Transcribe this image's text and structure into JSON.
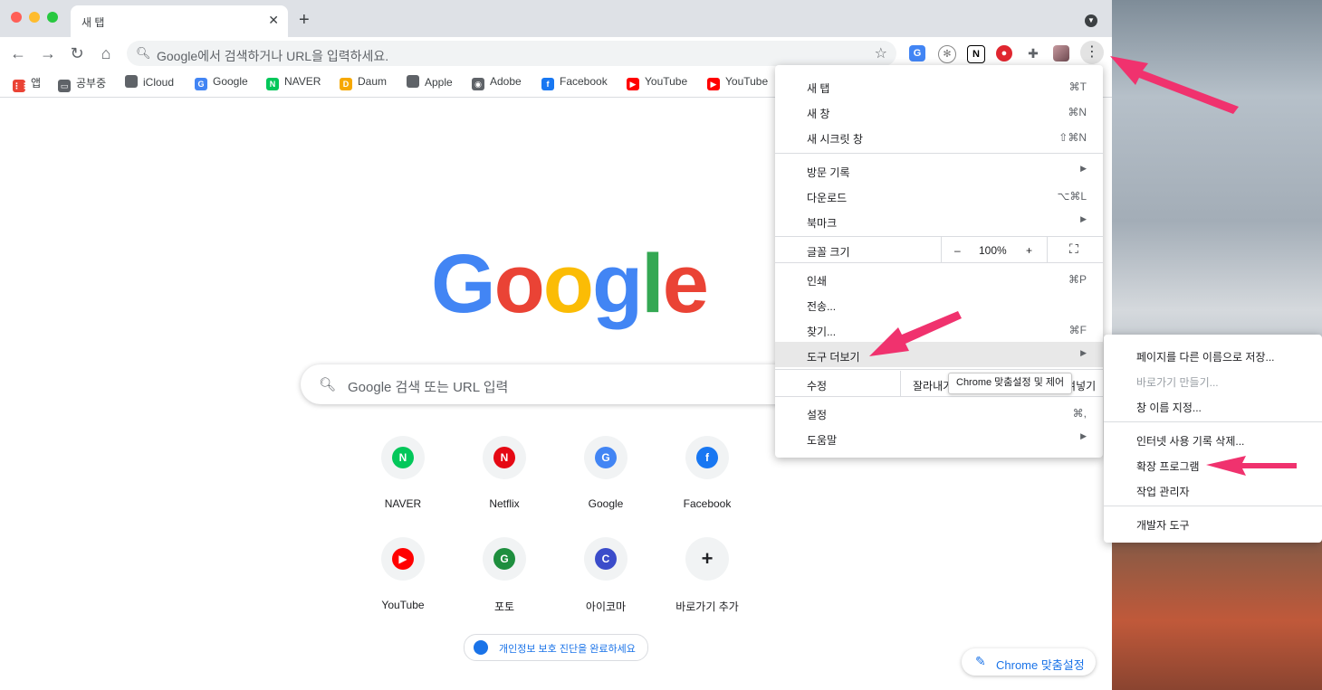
{
  "tab": {
    "title": "새 탭"
  },
  "omnibox": {
    "placeholder": "Google에서 검색하거나 URL을 입력하세요."
  },
  "bookmarks": [
    {
      "label": "앱",
      "icon": "apps-grid-icon"
    },
    {
      "label": "공부중",
      "icon": "folder-icon"
    },
    {
      "label": "iCloud",
      "icon": "apple-icon"
    },
    {
      "label": "Google",
      "icon": "google-icon"
    },
    {
      "label": "NAVER",
      "icon": "naver-icon"
    },
    {
      "label": "Daum",
      "icon": "daum-icon"
    },
    {
      "label": "Apple",
      "icon": "apple-icon"
    },
    {
      "label": "Adobe",
      "icon": "adobe-icon"
    },
    {
      "label": "Facebook",
      "icon": "facebook-icon"
    },
    {
      "label": "YouTube",
      "icon": "youtube-icon"
    },
    {
      "label": "YouTube",
      "icon": "youtube-music-icon"
    }
  ],
  "logo": {
    "letters": [
      "G",
      "o",
      "o",
      "g",
      "l",
      "e"
    ],
    "colors": [
      "#4285f4",
      "#ea4335",
      "#fbbc05",
      "#4285f4",
      "#34a853",
      "#ea4335"
    ]
  },
  "search": {
    "placeholder": "Google 검색 또는 URL 입력"
  },
  "tiles": [
    {
      "label": "NAVER",
      "glyph": "N",
      "color": "#03c75a"
    },
    {
      "label": "Netflix",
      "glyph": "N",
      "color": "#e50914"
    },
    {
      "label": "Google",
      "glyph": "G",
      "color": "#4285f4"
    },
    {
      "label": "Facebook",
      "glyph": "f",
      "color": "#1877f2"
    },
    {
      "label": "YouTube",
      "glyph": "▶",
      "color": "#ff0000"
    },
    {
      "label": "포토",
      "glyph": "G",
      "color": "#1e8e3e"
    },
    {
      "label": "아이코마",
      "glyph": "C",
      "color": "#3b4cca"
    },
    {
      "label": "바로가기 추가",
      "glyph": "+",
      "color": "#202124"
    }
  ],
  "privacy": {
    "label": "개인정보 보호 진단을 완료하세요"
  },
  "customize": {
    "label": "Chrome 맞춤설정"
  },
  "menu": {
    "new_tab": "새 탭",
    "new_tab_sc": "⌘T",
    "new_window": "새 창",
    "new_window_sc": "⌘N",
    "incognito": "새 시크릿 창",
    "incognito_sc": "⇧⌘N",
    "history": "방문 기록",
    "downloads": "다운로드",
    "downloads_sc": "⌥⌘L",
    "bookmarks": "북마크",
    "zoom": "글꼴 크기",
    "zoom_minus": "–",
    "zoom_value": "100%",
    "zoom_plus": "+",
    "print": "인쇄",
    "print_sc": "⌘P",
    "cast": "전송...",
    "find": "찾기...",
    "find_sc": "⌘F",
    "more_tools": "도구 더보기",
    "edit": "수정",
    "cut": "잘라내기",
    "paste": "붙여넣기",
    "settings": "설정",
    "settings_sc": "⌘,",
    "help": "도움말"
  },
  "tooltip": {
    "label": "Chrome 맞춤설정 및 제어"
  },
  "submenu": {
    "save_as": "페이지를 다른 이름으로 저장...",
    "shortcut": "바로가기 만들기...",
    "name_window": "창 이름 지정...",
    "clear_data": "인터넷 사용 기록 삭제...",
    "extensions": "확장 프로그램",
    "task_manager": "작업 관리자",
    "dev_tools": "개발자 도구"
  },
  "colors": {
    "accent": "#1a73e8",
    "arrow": "#f0326e"
  }
}
